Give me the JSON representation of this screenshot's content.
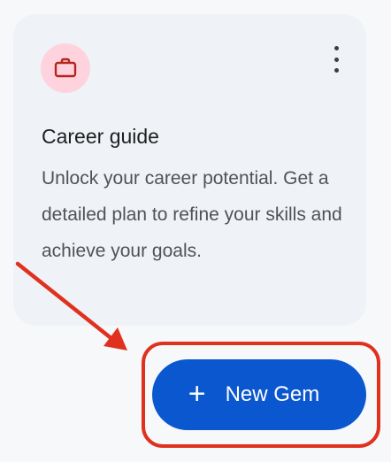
{
  "card": {
    "title": "Career guide",
    "description": "Unlock your career potential. Get a detailed plan to refine your skills and achieve your goals.",
    "icon": "briefcase-icon",
    "menu_icon": "more-vert-icon",
    "badge_color": "#ffd3de",
    "icon_color": "#b3261e"
  },
  "new_gem_button": {
    "icon": "+",
    "label": "New Gem",
    "color": "#0b57d0"
  },
  "annotation": {
    "color": "#e0311f"
  }
}
